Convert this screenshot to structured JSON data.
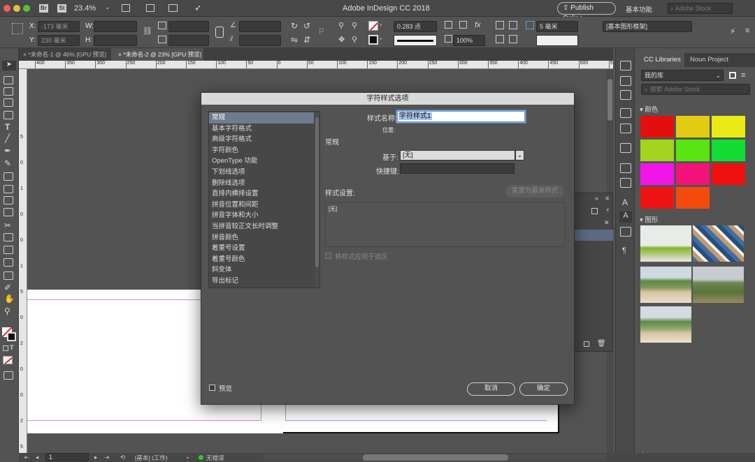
{
  "app": {
    "title": "Adobe InDesign CC 2018",
    "publish_label": "Publish Online",
    "workspace_label": "基本功能",
    "search_placeholder": "Adobe Stock",
    "badges": {
      "br": "Br",
      "st": "St"
    },
    "zoom": "23.4%"
  },
  "control": {
    "x_label": "X:",
    "x_value": "-173 毫米",
    "y_label": "Y:",
    "y_value": "230 毫米",
    "w_label": "W:",
    "h_label": "H:",
    "stroke_weight": "0.283 点",
    "opacity": "100%",
    "offset": "5 毫米",
    "frame_style": "[基本图形框架]"
  },
  "tabs": [
    {
      "label": "*未命名-1 @ 46% [GPU 预览]"
    },
    {
      "label": "*未命名-2 @ 23% [GPU 预览]"
    }
  ],
  "ruler": {
    "ticks": [
      "400",
      "350",
      "300",
      "250",
      "200",
      "150",
      "100",
      "50",
      "0",
      "50",
      "100",
      "150",
      "200",
      "250",
      "300",
      "350",
      "400",
      "450",
      "500",
      "550"
    ]
  },
  "vruler": {
    "ticks": [
      "5",
      "0",
      "1",
      "0",
      "0",
      "1",
      "5",
      "0",
      "2",
      "0",
      "0",
      "2",
      "5",
      "0"
    ]
  },
  "dialog": {
    "title": "字符样式选项",
    "categories": [
      "常规",
      "基本字符格式",
      "高级字符格式",
      "字符颜色",
      "OpenType 功能",
      "下划线选项",
      "删除线选项",
      "直排内横排设置",
      "拼音位置和间距",
      "拼音字体和大小",
      "当拼音较正文长时调整",
      "拼音颜色",
      "着重号设置",
      "着重号颜色",
      "斜变体",
      "导出标记"
    ],
    "style_name_label": "样式名称:",
    "style_name_value": "字符样式1",
    "location_label": "位置:",
    "section_title": "常规",
    "based_on_label": "基于:",
    "based_on_value": "[无]",
    "shortcut_label": "快捷键:",
    "settings_label": "样式设置:",
    "reset_button": "重置为基准样式",
    "settings_value": "[无]",
    "apply_label": "将样式应用于选区",
    "preview_label": "预览",
    "cancel": "取消",
    "ok": "确定"
  },
  "panel": {
    "tabs": [
      "CC Libraries",
      "Noun Project"
    ],
    "library": "我的库",
    "search_placeholder": "搜索 Adobe Stock",
    "colors_label": "颜色",
    "graphics_label": "图形",
    "colors": [
      "#e30f0f",
      "#e2cd12",
      "#eaea17",
      "#a3d41f",
      "#59e610",
      "#13dd34",
      "#f215e9",
      "#f21278",
      "#ef1010",
      "#ef1414",
      "#f54a0d"
    ]
  },
  "status": {
    "page": "1",
    "mode": "[基本] (工作)",
    "errors": "无错误"
  }
}
